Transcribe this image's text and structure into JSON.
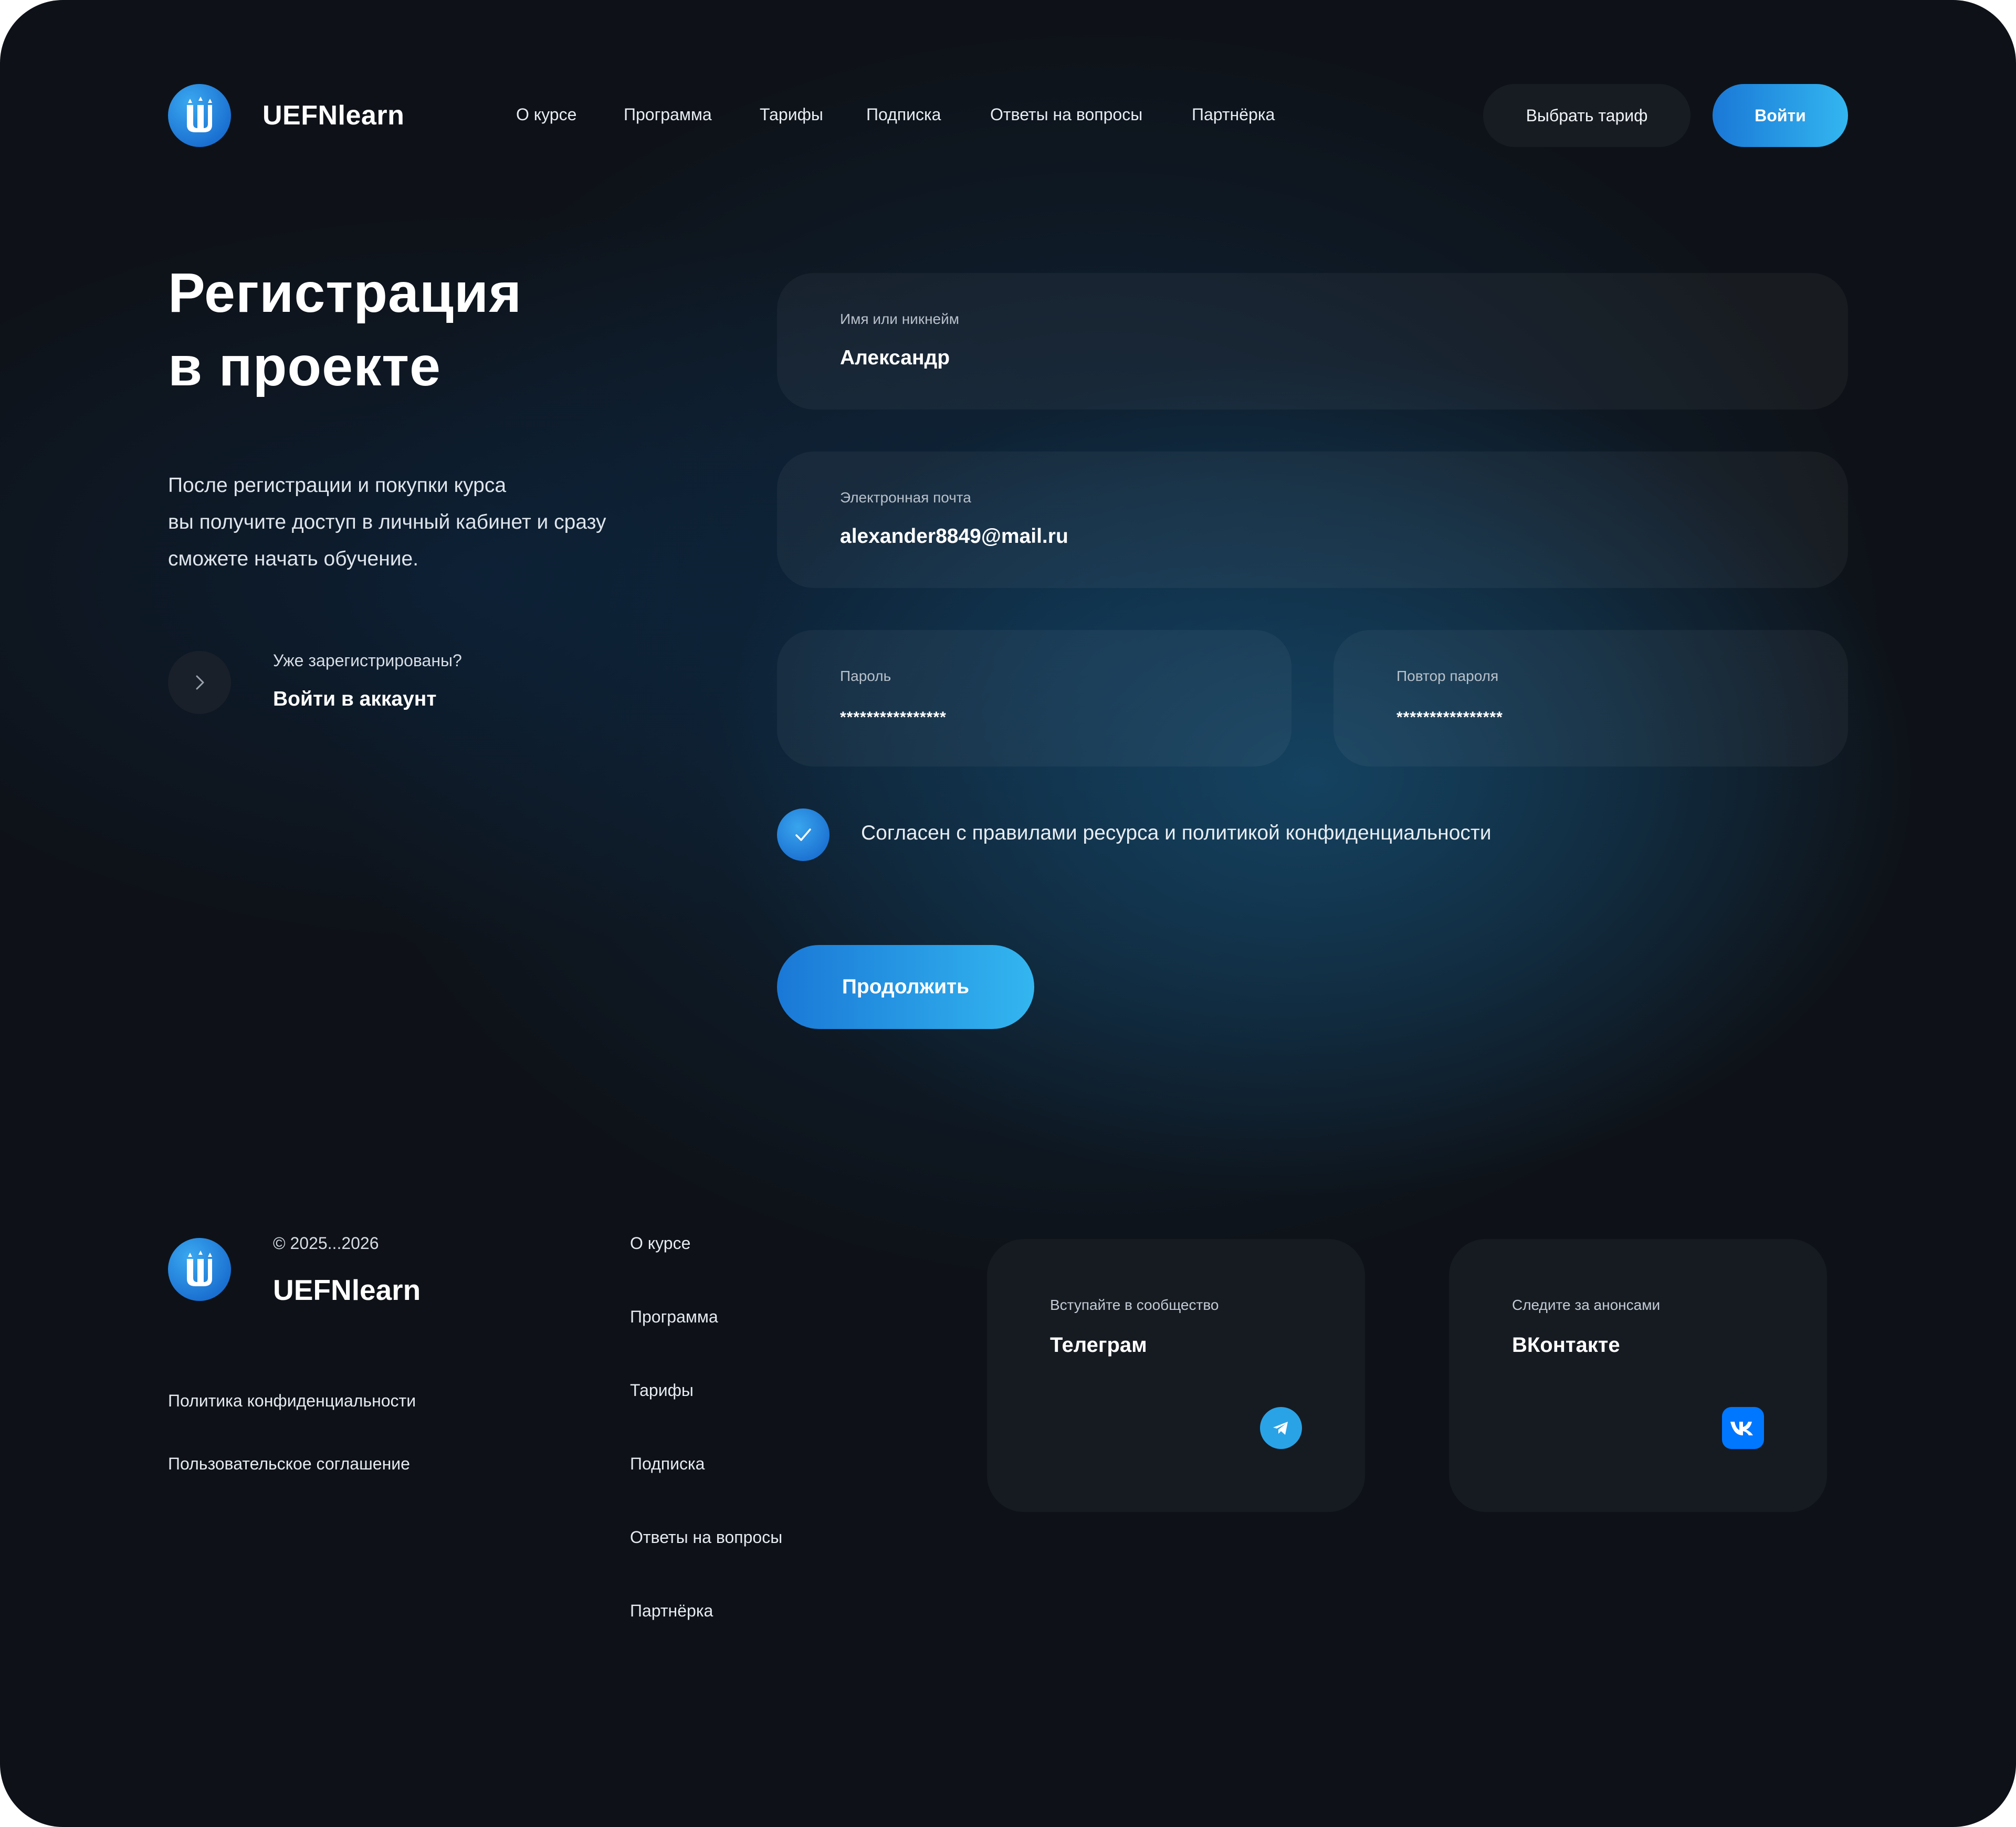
{
  "header": {
    "brand": "UEFNlearn",
    "nav": [
      "О курсе",
      "Программа",
      "Тарифы",
      "Подписка",
      "Ответы на вопросы",
      "Партнёрка"
    ],
    "choose_plan_label": "Выбрать тариф",
    "login_label": "Войти"
  },
  "intro": {
    "title_line1": "Регистрация",
    "title_line2": "в проекте",
    "lead_line1": "После регистрации и покупки курса",
    "lead_line2": "вы получите доступ в личный кабинет и сразу",
    "lead_line3": "сможете начать обучение.",
    "already_registered": "Уже зарегистрированы?",
    "login_account": "Войти в аккаунт"
  },
  "form": {
    "name": {
      "label": "Имя или никнейм",
      "value": "Александр"
    },
    "email": {
      "label": "Электронная почта",
      "value": "alexander8849@mail.ru"
    },
    "password": {
      "label": "Пароль",
      "value": "****************"
    },
    "password_repeat": {
      "label": "Повтор пароля",
      "value": "****************"
    },
    "agree_label": "Согласен с правилами ресурса и политикой конфиденциальности",
    "agree_checked": true,
    "submit_label": "Продолжить"
  },
  "footer": {
    "copyright": "© 2025...2026",
    "brand": "UEFNlearn",
    "legal": [
      "Политика конфиденциальности",
      "Пользовательское соглашение"
    ],
    "nav": [
      "О курсе",
      "Программа",
      "Тарифы",
      "Подписка",
      "Ответы на вопросы",
      "Партнёрка"
    ],
    "telegram": {
      "label": "Вступайте в сообщество",
      "name": "Телеграм",
      "icon": "telegram-icon"
    },
    "vk": {
      "label": "Следите за анонсами",
      "name": "ВКонтакте",
      "icon": "vk-icon"
    }
  },
  "colors": {
    "background": "#0e1218",
    "accent_start": "#1a78d6",
    "accent_end": "#33b6f0",
    "vk_blue": "#0077ff",
    "telegram_blue": "#2aa3e6"
  }
}
